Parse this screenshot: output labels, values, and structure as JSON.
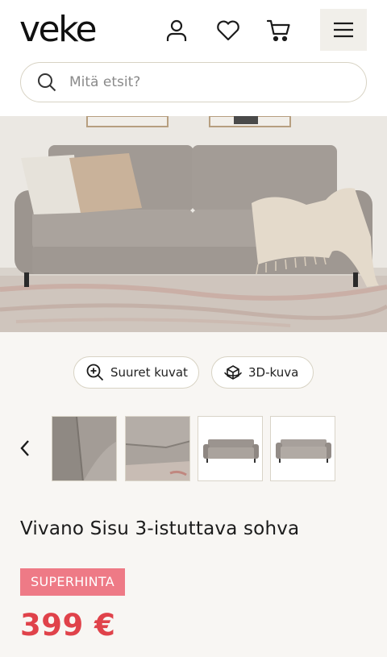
{
  "header": {
    "logo_text": "veke",
    "icons": [
      "user-icon",
      "heart-icon",
      "cart-icon",
      "menu-icon"
    ]
  },
  "search": {
    "placeholder": "Mitä etsit?",
    "value": ""
  },
  "gallery": {
    "actions": [
      {
        "label": "Suuret kuvat",
        "icon": "zoom-in-icon"
      },
      {
        "label": "3D-kuva",
        "icon": "rotate-3d-icon"
      }
    ],
    "thumbnails": [
      "fabric-detail-1",
      "fabric-detail-2",
      "sofa-front",
      "sofa-front-alt"
    ]
  },
  "product": {
    "title": "Vivano Sisu 3-istuttava sohva",
    "badge": "SUPERHINTA",
    "price": "399 €"
  },
  "colors": {
    "badge_bg": "#ee7a86",
    "price": "#e0424a",
    "page_bg": "#f8f6f3",
    "border": "#d8d3c4"
  }
}
